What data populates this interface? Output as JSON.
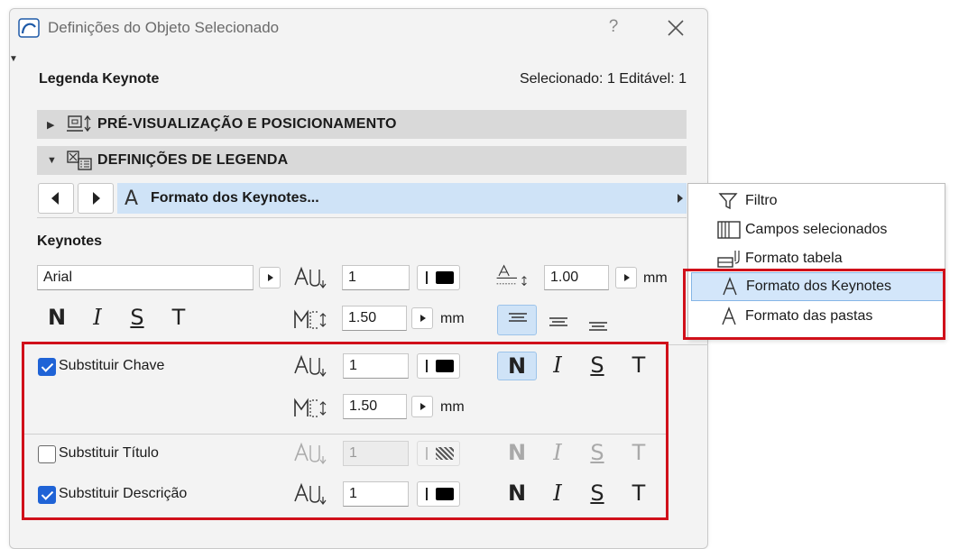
{
  "window": {
    "title": "Definições do Objeto Selecionado",
    "help_label": "?"
  },
  "header": {
    "heading": "Legenda Keynote",
    "selection_info": "Selecionado: 1 Editável: 1"
  },
  "sections": [
    {
      "title": "PRÉ-VISUALIZAÇÃO E POSICIONAMENTO",
      "expanded": false
    },
    {
      "title": "DEFINIÇÕES DE LEGENDA",
      "expanded": true
    }
  ],
  "format_bar": {
    "label": "Formato dos Keynotes..."
  },
  "keynotes": {
    "heading": "Keynotes",
    "font": "Arial",
    "text_size": "1",
    "line_spacing": "1.00",
    "line_spacing_unit": "mm",
    "width_factor": "1.50",
    "width_factor_unit": "mm",
    "styles": {
      "bold": "N",
      "italic": "I",
      "underline": "S",
      "strike": "T"
    },
    "alignment_selected": "left"
  },
  "overrides": {
    "key": {
      "label": "Substituir Chave",
      "checked": true,
      "text_size": "1",
      "width_factor": "1.50",
      "width_unit": "mm",
      "bold_active": true
    },
    "title": {
      "label": "Substituir Título",
      "checked": false,
      "text_size": "1"
    },
    "description": {
      "label": "Substituir Descrição",
      "checked": true,
      "text_size": "1"
    }
  },
  "menu": {
    "items": [
      {
        "label": "Filtro",
        "icon": "filter-icon"
      },
      {
        "label": "Campos selecionados",
        "icon": "columns-icon"
      },
      {
        "label": "Formato tabela",
        "icon": "table-format-icon"
      },
      {
        "label": "Formato dos Keynotes",
        "icon": "text-format-icon",
        "selected": true
      },
      {
        "label": "Formato das pastas",
        "icon": "text-format-icon"
      }
    ]
  },
  "colors": {
    "accent": "#1f63d6",
    "highlight": "#cfe3f7",
    "annotation": "#d0101a",
    "section_bar": "#d9d9d9"
  }
}
